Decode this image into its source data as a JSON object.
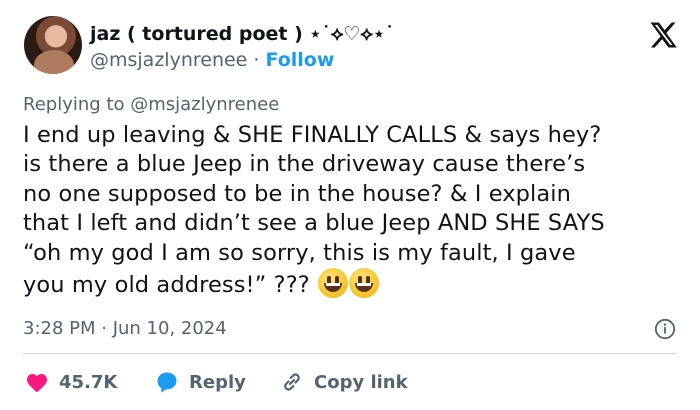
{
  "author": {
    "display_name": "jaz ( tortured poet ) ⋆˙⟡♡⟡⋆˙",
    "handle": "@msjazlynrenee",
    "separator": "·",
    "follow_label": "Follow"
  },
  "reply_context": "Replying to @msjazlynrenee",
  "tweet_lines": [
    "I end up leaving & SHE FINALLY CALLS & says hey?",
    "is there a blue Jeep in the driveway cause there’s",
    "no one supposed to be in the house? & I explain",
    "that I left and didn’t see a blue Jeep AND SHE SAYS",
    "“oh my god I am so sorry, this is my fault, I gave",
    "you my old address!” ???"
  ],
  "timestamp": "3:28 PM · Jun 10, 2024",
  "actions": {
    "like_count": "45.7K",
    "reply_label": "Reply",
    "copy_label": "Copy link"
  },
  "colors": {
    "link": "#1d9bf0",
    "secondary_text": "#536471",
    "heart": "#f91880"
  },
  "icons": [
    "x-logo-icon",
    "info-icon",
    "heart-icon",
    "reply-icon",
    "link-icon",
    "grinning-face-emoji"
  ]
}
